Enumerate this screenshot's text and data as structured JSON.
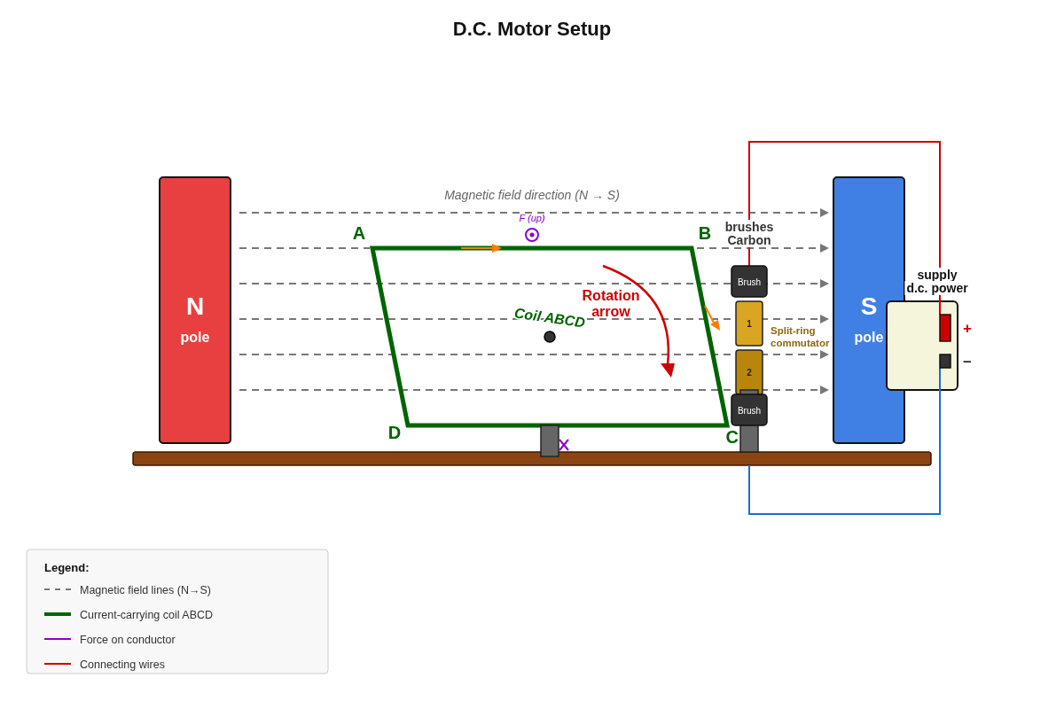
{
  "title": "D.C. Motor Setup",
  "field": {
    "label": "Magnetic field direction (N → S)"
  },
  "magnets": [
    {
      "kind": "north",
      "letter": "N",
      "label": "pole"
    },
    {
      "kind": "south",
      "letter": "S",
      "label": "pole"
    }
  ],
  "coil": {
    "label": "Coil ABCD",
    "corners": [
      "A",
      "B",
      "C",
      "D"
    ]
  },
  "force": {
    "label": "F (up)"
  },
  "rotation": {
    "label": [
      "Rotation",
      "arrow"
    ]
  },
  "brushes": {
    "label": [
      "brushes",
      "Carbon"
    ],
    "items": [
      "Brush",
      "Brush"
    ]
  },
  "commutator": {
    "label": [
      "Split-ring",
      "commutator"
    ],
    "segments": [
      "1",
      "2"
    ]
  },
  "power_supply": {
    "label": [
      "supply",
      "d.c. power"
    ],
    "terminals": [
      {
        "kind": "positive",
        "sign": "+"
      },
      {
        "kind": "negative",
        "sign": "−"
      }
    ]
  },
  "legend": {
    "title": "Legend:",
    "items": [
      {
        "kind": "dashed",
        "label": "Magnetic field lines (N→S)",
        "color": "#777777"
      },
      {
        "kind": "thick",
        "label": "Current-carrying coil ABCD",
        "color": "#006400"
      },
      {
        "kind": "line",
        "label": "Force on conductor",
        "color": "#8e00c8"
      },
      {
        "kind": "line",
        "label": "Connecting wires",
        "color": "#cc0000"
      }
    ]
  }
}
